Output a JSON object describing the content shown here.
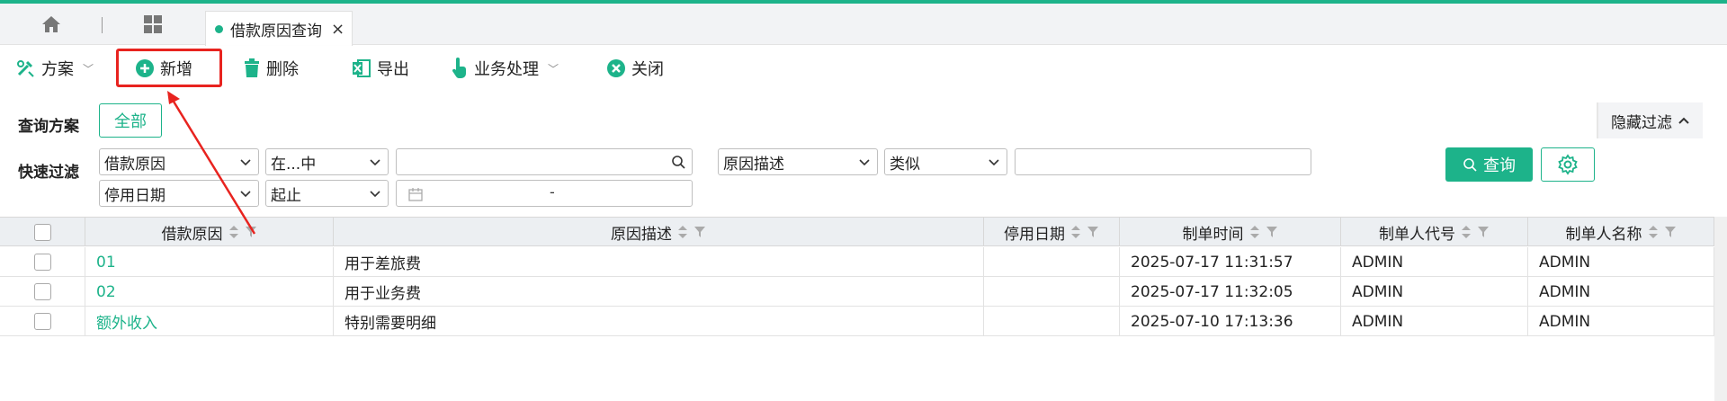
{
  "tabs": {
    "active_label": "借款原因查询",
    "close": "×"
  },
  "toolbar": {
    "plan_label": "方案",
    "add_label": "新增",
    "delete_label": "删除",
    "export_label": "导出",
    "business_label": "业务处理",
    "close_label": "关闭"
  },
  "filter": {
    "query_plan_label": "查询方案",
    "all_label": "全部",
    "quick_filter_label": "快速过滤",
    "hide_filter_label": "隐藏过滤",
    "row1": {
      "field1": "借款原因",
      "op1": "在...中",
      "field2": "原因描述",
      "op2": "类似"
    },
    "row2": {
      "field1": "停用日期",
      "op1": "起止",
      "date_sep": "-"
    },
    "query_label": "查询"
  },
  "table": {
    "columns": [
      "借款原因",
      "原因描述",
      "停用日期",
      "制单时间",
      "制单人代号",
      "制单人名称"
    ],
    "rows": [
      {
        "reason": "01",
        "desc": "用于差旅费",
        "disable_date": "",
        "created": "2025-07-17 11:31:57",
        "creator_code": "ADMIN",
        "creator_name": "ADMIN"
      },
      {
        "reason": "02",
        "desc": "用于业务费",
        "disable_date": "",
        "created": "2025-07-17 11:32:05",
        "creator_code": "ADMIN",
        "creator_name": "ADMIN"
      },
      {
        "reason": "额外收入",
        "desc": "特别需要明细",
        "disable_date": "",
        "created": "2025-07-10 17:13:36",
        "creator_code": "ADMIN",
        "creator_name": "ADMIN"
      }
    ]
  },
  "colors": {
    "accent": "#1db38a",
    "highlight": "#e8231f"
  }
}
